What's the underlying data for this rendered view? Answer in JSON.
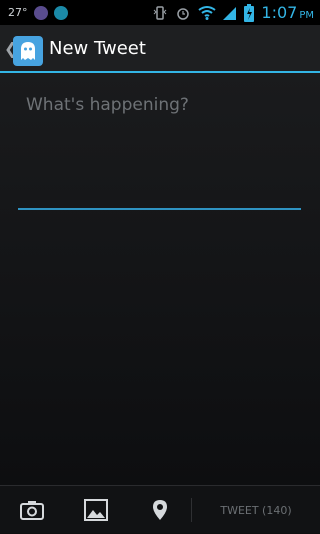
{
  "status_bar": {
    "temperature": "27°",
    "time": "1:07",
    "ampm": "PM",
    "icons": [
      "weather-app-icon",
      "notification-dot-icon",
      "vibrate-icon",
      "alarm-icon",
      "wifi-icon",
      "signal-icon",
      "battery-charging-icon"
    ],
    "colors": {
      "accent": "#33b5e5",
      "dot_purple": "#5a4c8e",
      "dot_teal": "#1b8aa8"
    }
  },
  "action_bar": {
    "title": "New Tweet",
    "up_icon": "chevron-left-icon",
    "app_icon": "app-ghost-icon"
  },
  "compose": {
    "placeholder": "What's happening?",
    "value": ""
  },
  "bottom_bar": {
    "icons": [
      "camera-icon",
      "image-icon",
      "location-pin-icon"
    ],
    "tweet_label": "TWEET (140)"
  }
}
